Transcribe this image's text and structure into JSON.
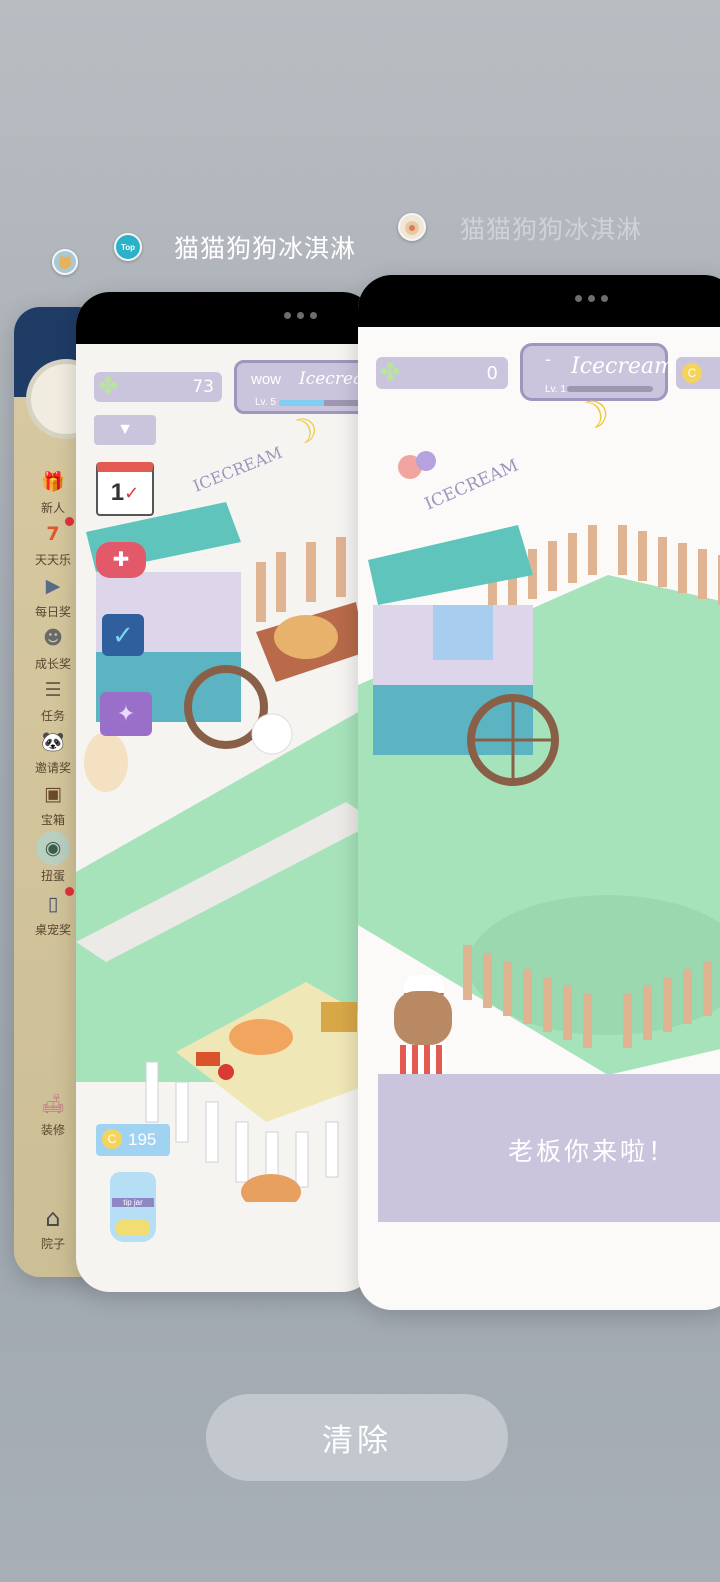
{
  "recent_apps": {
    "back_app": {
      "icon": "cat-game-icon"
    },
    "middle_app": {
      "title": "猫猫狗狗冰淇淋",
      "icon_badge": "Top"
    },
    "front_app": {
      "title": "猫猫狗狗冰淇淋",
      "icon": "cat-game-icon"
    }
  },
  "card1": {
    "menu": [
      {
        "label": "新人",
        "icon": "gift-icon",
        "badge": false
      },
      {
        "label": "天天乐",
        "icon": "lucky-seven-icon",
        "badge": true
      },
      {
        "label": "每日奖",
        "icon": "video-reward-icon",
        "badge": false
      },
      {
        "label": "成长奖",
        "icon": "growth-reward-icon",
        "badge": false
      },
      {
        "label": "任务",
        "icon": "task-list-icon",
        "badge": false
      },
      {
        "label": "邀请奖",
        "icon": "invite-panda-icon",
        "badge": false
      },
      {
        "label": "宝箱",
        "icon": "treasure-chest-icon",
        "badge": false
      },
      {
        "label": "扭蛋",
        "icon": "gacha-machine-icon",
        "badge": false
      },
      {
        "label": "桌宠奖",
        "icon": "desk-pet-icon",
        "badge": true
      },
      {
        "label": "装修",
        "icon": "sofa-icon",
        "badge": false
      },
      {
        "label": "院子",
        "icon": "house-icon",
        "badge": false
      }
    ]
  },
  "card2": {
    "clover_count": "73",
    "shop_sign_prefix": "wow",
    "shop_sign_name": "Icecream",
    "shop_level": "Lv. 5",
    "level_progress": 0.45,
    "stand_sign": "ICECREAM",
    "calendar_day": "1",
    "coin_jar_count": "195",
    "jar_label": "tip jar"
  },
  "card3": {
    "clover_count": "0",
    "shop_sign_prefix": "-",
    "shop_sign_name": "Icecream",
    "shop_level": "Lv. 1",
    "level_progress": 0,
    "stand_sign": "ICECREAM",
    "dialog_text": "老板你来啦！"
  },
  "clear_label": "清除",
  "colors": {
    "accent_purple": "#cbc4dd",
    "grass": "#a6e3bb",
    "awning_teal": "#5fc4bc",
    "fence": "#e0b392"
  }
}
